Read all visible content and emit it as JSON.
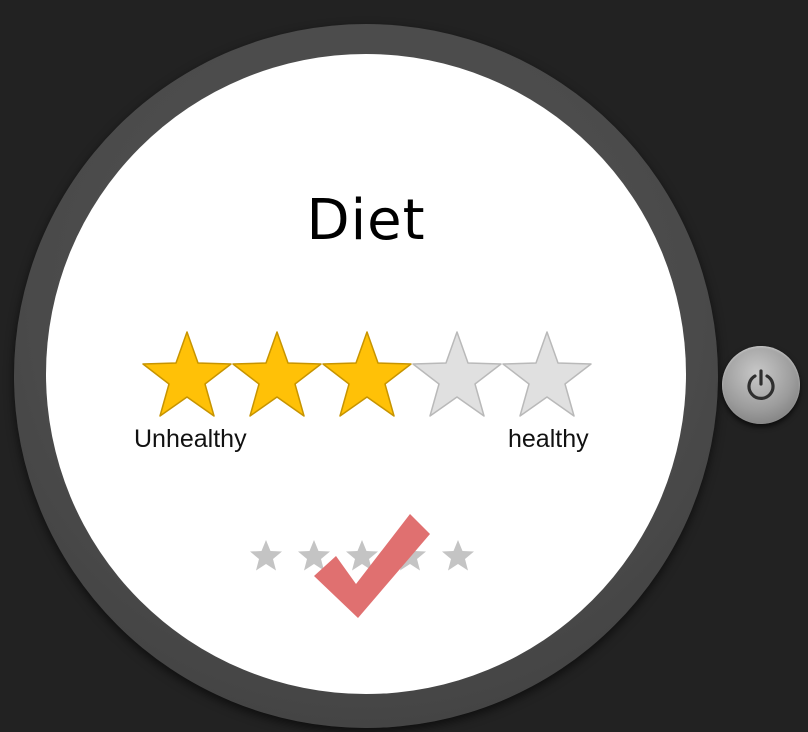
{
  "screen": {
    "title": "Diet"
  },
  "rating": {
    "value": 3,
    "max": 5,
    "label_low": "Unhealthy",
    "label_high": "healthy",
    "filled_color": "#ffc107",
    "empty_color": "#e0e0e0"
  },
  "page_indicator": {
    "count": 5,
    "color": "#c4c4c4"
  },
  "confirm": {
    "icon": "checkmark-icon",
    "color": "#e07070"
  },
  "hardware": {
    "power_icon": "power-icon"
  }
}
